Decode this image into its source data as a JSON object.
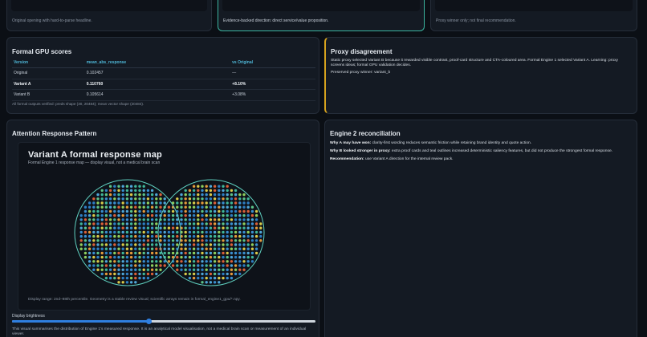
{
  "top_cards": [
    {
      "note": "Original opening with hard-to-parse headline."
    },
    {
      "note": "Evidence-backed direction: direct service/value proposition."
    },
    {
      "note": "Proxy winner only; not final recommendation."
    }
  ],
  "gpu": {
    "title": "Formal GPU scores",
    "columns": [
      "Version",
      "mean_abs_response",
      "vs Original"
    ],
    "rows": [
      {
        "version": "Original",
        "score": "0.102457",
        "delta": "—"
      },
      {
        "version": "Variant A",
        "score": "0.110760",
        "delta": "+8.10%"
      },
      {
        "version": "Variant B",
        "score": "0.105614",
        "delta": "+3.08%"
      }
    ],
    "footnote": "All formal outputs verified: preds shape (30, 20484); mean vector shape (20484)."
  },
  "proxy": {
    "title": "Proxy disagreement",
    "body": "Static proxy selected Variant B because it rewarded visible contrast, proof-card structure and CTA-coloured area. Formal Engine 1 selected Variant A. Learning: proxy screens ideas; formal GPU validation decides.",
    "winner": "Preserved proxy winner: variant_b"
  },
  "attention": {
    "title": "Attention Response Pattern",
    "map_title": "Variant A formal response map",
    "map_subtitle": "Formal Engine 1 response map — display visual, not a medical brain scan",
    "range_note": "Display range: 2nd–98th percentile. Geometry is a stable review visual; scientific arrays remain in formal_engine1_gpu/*.npy.",
    "brightness_label": "Display brightness",
    "brightness_level": 0.45,
    "footnote": "This visual summarises the distribution of Engine 1's measured response. It is an analytical model visualisation, not a medical brain scan or measurement of an individual viewer."
  },
  "engine2": {
    "title": "Engine 2 reconciliation",
    "items": [
      {
        "label": "Why A may have won:",
        "text": "clarity-first wording reduces semantic friction while retaining brand identity and quote action."
      },
      {
        "label": "Why B looked stronger in proxy:",
        "text": "extra proof cards and teal outlines increased deterministic saliency features, but did not produce the strongest formal response."
      },
      {
        "label": "Recommendation:",
        "text": "use Variant A direction for the internal review pack."
      }
    ]
  },
  "colors": {
    "teal_outline": "#3bb5a0",
    "amber_accent": "#d6a21e",
    "header_blue": "#4fb8d8",
    "slider_blue": "#2f7fe0"
  }
}
